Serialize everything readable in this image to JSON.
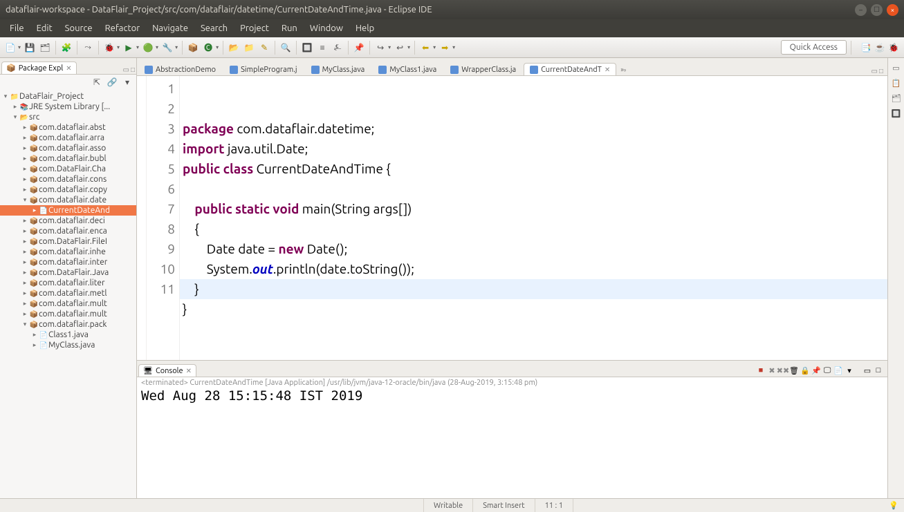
{
  "window": {
    "title": "dataflair-workspace - DataFlair_Project/src/com/dataflair/datetime/CurrentDateAndTime.java - Eclipse IDE"
  },
  "menu": [
    "File",
    "Edit",
    "Source",
    "Refactor",
    "Navigate",
    "Search",
    "Project",
    "Run",
    "Window",
    "Help"
  ],
  "toolbar": {
    "quick_access": "Quick Access"
  },
  "explorer": {
    "title": "Package Expl",
    "project": "DataFlair_Project",
    "jre": "JRE System Library [...",
    "src": "src",
    "packages": [
      "com.dataflair.abst",
      "com.dataflair.arra",
      "com.dataflair.asso",
      "com.dataflair.bubl",
      "com.DataFlair.Cha",
      "com.dataflair.cons",
      "com.dataflair.copy",
      "com.dataflair.date",
      "com.dataflair.deci",
      "com.dataflair.enca",
      "com.DataFlair.FileI",
      "com.dataflair.inhe",
      "com.dataflair.inter",
      "com.DataFlair.Java",
      "com.dataflair.liter",
      "com.dataflair.metl",
      "com.dataflair.mult",
      "com.dataflair.mult",
      "com.dataflair.pack"
    ],
    "date_child": "CurrentDateAnd",
    "pack_children": [
      "Class1.java",
      "MyClass.java"
    ]
  },
  "editor": {
    "tabs": [
      "AbstractionDemo",
      "SimpleProgram.j",
      "MyClass.java",
      "MyClass1.java",
      "WrapperClass.ja",
      "CurrentDateAndT"
    ],
    "rest": "⁹",
    "rest_prefix": "»",
    "lines": [
      "1",
      "2",
      "3",
      "4",
      "5",
      "6",
      "7",
      "8",
      "9",
      "10",
      "11"
    ]
  },
  "code": {
    "l1a": "package",
    "l1b": " com.dataflair.datetime;",
    "l2a": "import",
    "l2b": " java.util.Date;",
    "l3a": "public",
    "l3b": "class",
    "l3c": " CurrentDateAndTime {",
    "l5a": "public",
    "l5b": "static",
    "l5c": "void",
    "l5d": " main(String args[])",
    "l6": "    {",
    "l7a": "        Date date = ",
    "l7b": "new",
    "l7c": " Date();",
    "l8a": "        System.",
    "l8b": "out",
    "l8c": ".println(date.toString());",
    "l9": "    }",
    "l10": "}"
  },
  "console": {
    "title": "Console",
    "status": "<terminated> CurrentDateAndTime [Java Application] /usr/lib/jvm/java-12-oracle/bin/java (28-Aug-2019, 3:15:48 pm)",
    "output": "Wed Aug 28 15:15:48 IST 2019"
  },
  "status": {
    "writable": "Writable",
    "insert": "Smart Insert",
    "pos": "11 : 1"
  }
}
